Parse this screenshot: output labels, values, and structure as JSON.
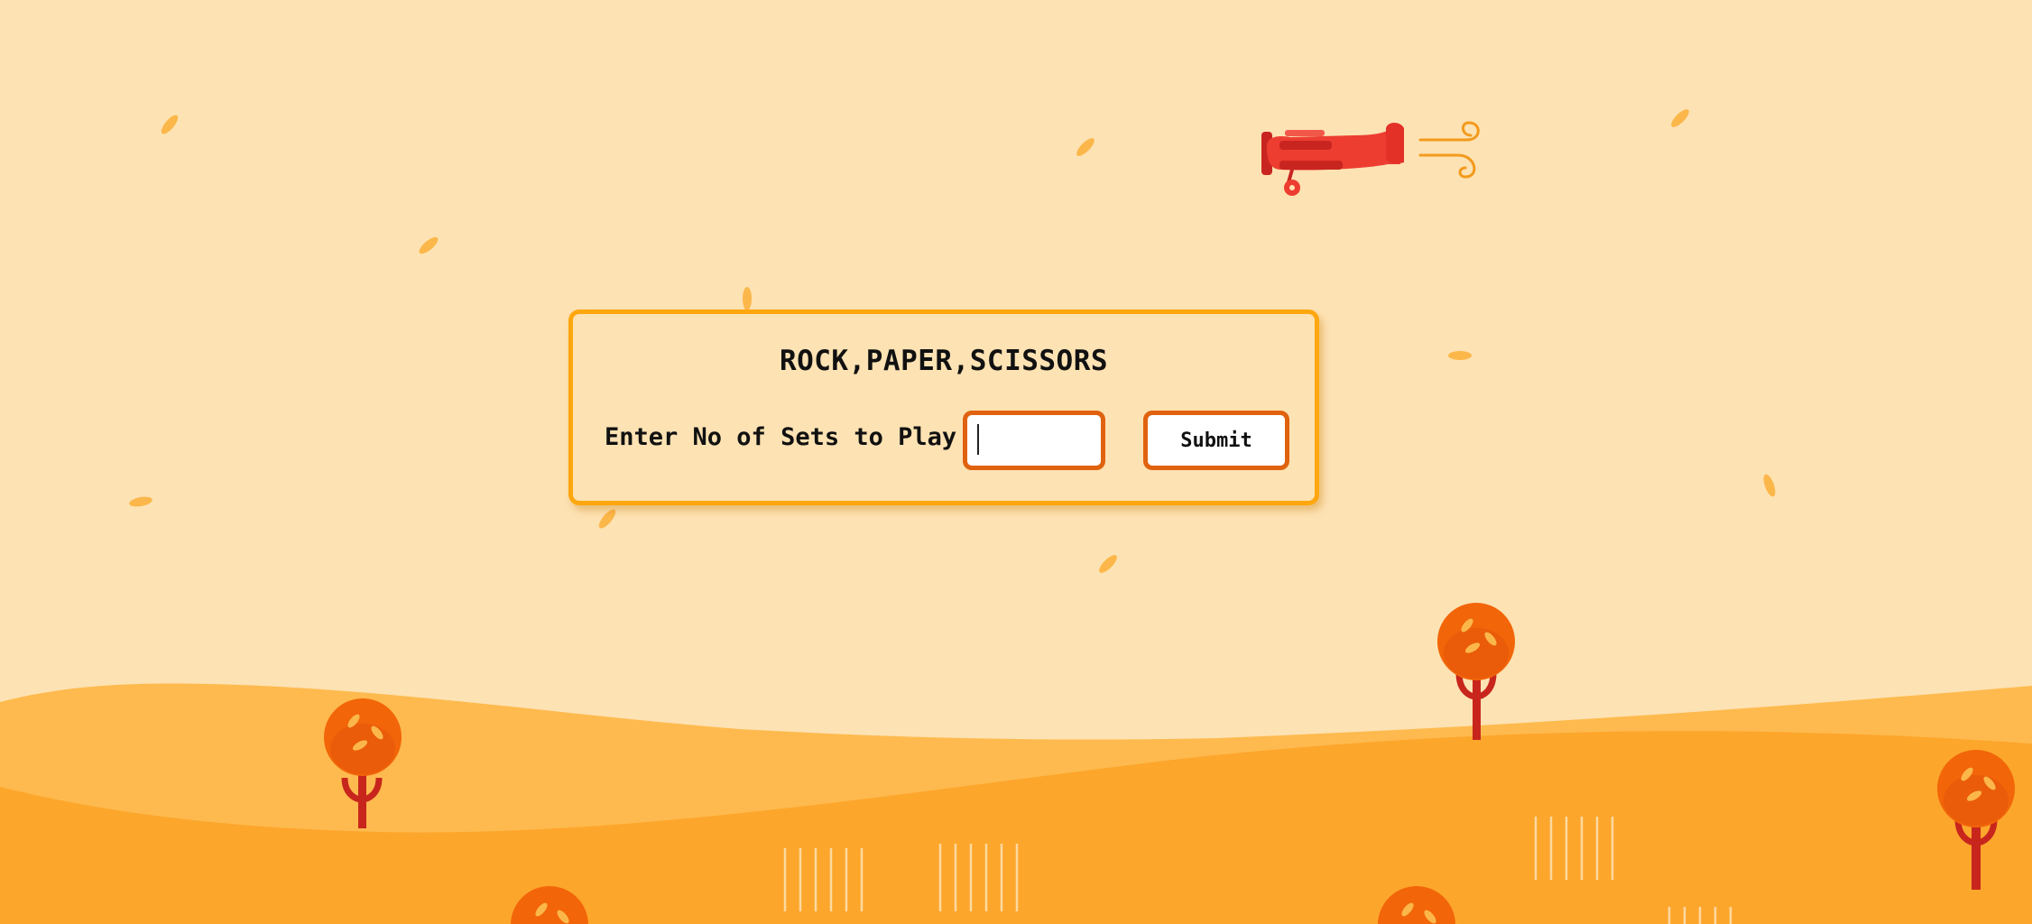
{
  "app": {
    "title": "ROCK,PAPER,SCISSORS"
  },
  "form": {
    "label": "Enter No of Sets to Play",
    "sets_value": "",
    "submit_label": "Submit"
  },
  "theme": {
    "background": "#fde2b3",
    "card_border": "#ffa70f",
    "control_border": "#e0620f",
    "hill_light": "#feb94c",
    "hill_mid": "#fda42a",
    "tree_top": "#f26508",
    "tree_trunk": "#c8261d",
    "plane": "#ed3d31"
  },
  "icons": [
    "biplane-icon",
    "wind-lines-icon",
    "leaf-icon",
    "tree-icon",
    "wheat-icon"
  ]
}
